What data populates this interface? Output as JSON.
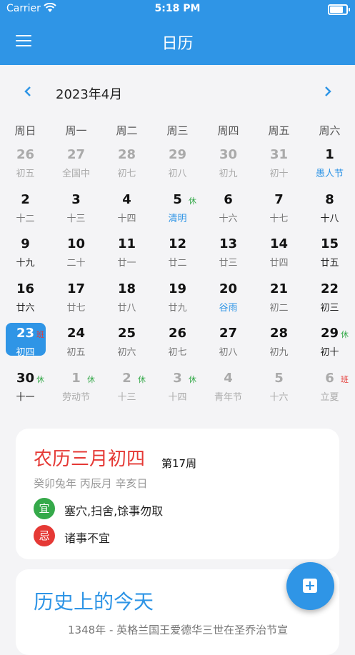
{
  "status": {
    "carrier": "Carrier",
    "time": "5:18 PM"
  },
  "appbar": {
    "title": "日历"
  },
  "nav": {
    "month": "2023年4月",
    "prev": "‹",
    "next": "›"
  },
  "weekdays": [
    "周日",
    "周一",
    "周二",
    "周三",
    "周四",
    "周五",
    "周六"
  ],
  "weeks": [
    [
      {
        "d": "26",
        "sub": "初五",
        "other": true
      },
      {
        "d": "27",
        "sub": "全国中",
        "other": true
      },
      {
        "d": "28",
        "sub": "初七",
        "other": true
      },
      {
        "d": "29",
        "sub": "初八",
        "other": true
      },
      {
        "d": "30",
        "sub": "初九",
        "other": true
      },
      {
        "d": "31",
        "sub": "初十",
        "other": true
      },
      {
        "d": "1",
        "sub": "愚人节",
        "fest": true
      }
    ],
    [
      {
        "d": "2",
        "sub": "十二"
      },
      {
        "d": "3",
        "sub": "十三"
      },
      {
        "d": "4",
        "sub": "十四"
      },
      {
        "d": "5",
        "sub": "清明",
        "fest": true,
        "tag": "休"
      },
      {
        "d": "6",
        "sub": "十六"
      },
      {
        "d": "7",
        "sub": "十七"
      },
      {
        "d": "8",
        "sub": "十八",
        "dark": true
      }
    ],
    [
      {
        "d": "9",
        "sub": "十九",
        "dark": true
      },
      {
        "d": "10",
        "sub": "二十"
      },
      {
        "d": "11",
        "sub": "廿一"
      },
      {
        "d": "12",
        "sub": "廿二"
      },
      {
        "d": "13",
        "sub": "廿三"
      },
      {
        "d": "14",
        "sub": "廿四"
      },
      {
        "d": "15",
        "sub": "廿五",
        "dark": true
      }
    ],
    [
      {
        "d": "16",
        "sub": "廿六",
        "dark": true
      },
      {
        "d": "17",
        "sub": "廿七"
      },
      {
        "d": "18",
        "sub": "廿八"
      },
      {
        "d": "19",
        "sub": "廿九"
      },
      {
        "d": "20",
        "sub": "谷雨",
        "fest": true
      },
      {
        "d": "21",
        "sub": "初二"
      },
      {
        "d": "22",
        "sub": "初三",
        "dark": true
      }
    ],
    [
      {
        "d": "23",
        "sub": "初四",
        "sel": true,
        "tag": "班",
        "work": true
      },
      {
        "d": "24",
        "sub": "初五"
      },
      {
        "d": "25",
        "sub": "初六"
      },
      {
        "d": "26",
        "sub": "初七"
      },
      {
        "d": "27",
        "sub": "初八"
      },
      {
        "d": "28",
        "sub": "初九"
      },
      {
        "d": "29",
        "sub": "初十",
        "dark": true,
        "tag": "休"
      }
    ],
    [
      {
        "d": "30",
        "sub": "十一",
        "dark": true,
        "tag": "休"
      },
      {
        "d": "1",
        "sub": "劳动节",
        "other": true,
        "tag": "休"
      },
      {
        "d": "2",
        "sub": "十三",
        "other": true,
        "tag": "休"
      },
      {
        "d": "3",
        "sub": "十四",
        "other": true,
        "tag": "休"
      },
      {
        "d": "4",
        "sub": "青年节",
        "other": true
      },
      {
        "d": "5",
        "sub": "十六",
        "other": true
      },
      {
        "d": "6",
        "sub": "立夏",
        "other": true,
        "tag": "班",
        "work": true
      }
    ]
  ],
  "lunar": {
    "title": "农历三月初四",
    "week": "第17周",
    "ganzhi": "癸卯兔年 丙辰月 辛亥日",
    "yi_label": "宜",
    "yi_text": "塞穴,扫舍,馀事勿取",
    "ji_label": "忌",
    "ji_text": "诸事不宜"
  },
  "history": {
    "title": "历史上的今天",
    "line": "1348年 - 英格兰国王爱德华三世在圣乔治节宣"
  },
  "colors": {
    "accent": "#2f95e6",
    "red": "#e53935",
    "green": "#35a94a"
  }
}
